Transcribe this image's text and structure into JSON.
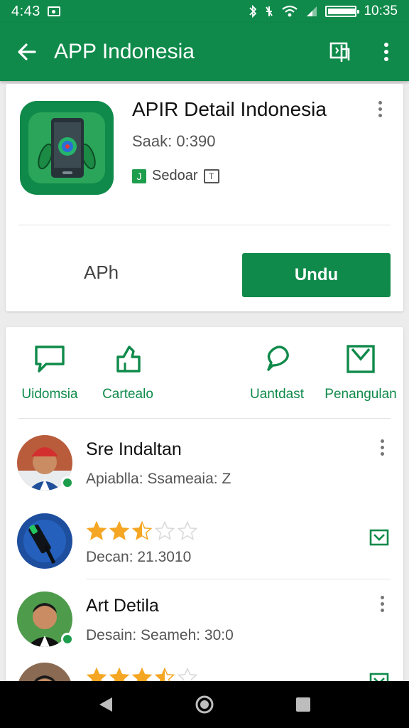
{
  "status_bar": {
    "time": "4:43",
    "clock": "10:35"
  },
  "app_bar": {
    "title": "APP Indonesia"
  },
  "app_card": {
    "name": "APIR Detail Indonesia",
    "meta": "Saak: 0:390",
    "badge_label": "Sedoar",
    "badge_j": "J",
    "badge_t": "T",
    "secondary_label": "APh",
    "primary_label": "Undu"
  },
  "quick_actions": [
    {
      "label": "Uidomsia",
      "icon": "chat-bubble-icon"
    },
    {
      "label": "Cartealo",
      "icon": "share-icon"
    },
    {
      "label": "Uantdast",
      "icon": "comment-icon"
    },
    {
      "label": "Penangulan",
      "icon": "checkbox-icon"
    }
  ],
  "list": [
    {
      "title": "Sre Indaltan",
      "subtitle": "Apiablla: Ssameaia: Z",
      "avatar": "person-red-cap",
      "online": true,
      "trailing": "more-vert-icon"
    },
    {
      "rating": 2.5,
      "max_rating": 5,
      "subtitle": "Decan: 21.3010",
      "avatar": "usb-device",
      "online": false,
      "trailing": "checkbox-icon"
    },
    {
      "title": "Art Detila",
      "subtitle": "Desain: Seameh: 30:0",
      "avatar": "person-green",
      "online": true,
      "trailing": "more-vert-icon"
    },
    {
      "rating": 3.5,
      "max_rating": 5,
      "avatar": "person-partial",
      "online": false,
      "trailing": "checkbox-icon"
    }
  ],
  "colors": {
    "brand": "#0f8a4a",
    "star": "#f5a623",
    "star_empty": "#d8d8d8"
  }
}
